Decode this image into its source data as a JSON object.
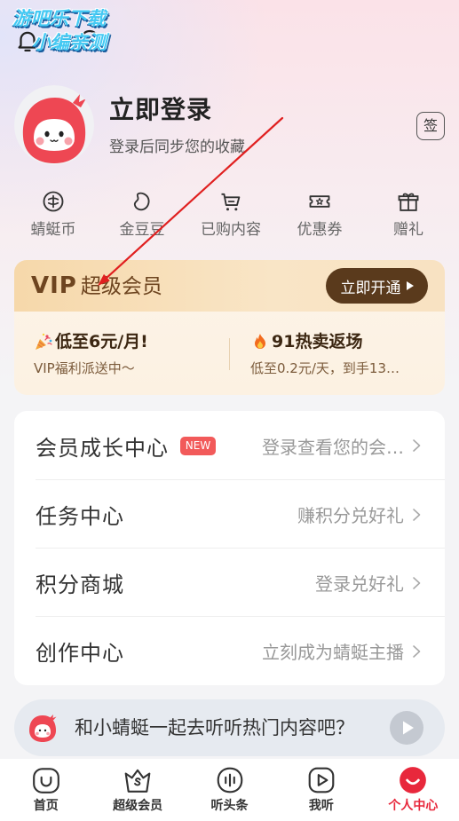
{
  "watermark": {
    "line1": "游吧乐下载",
    "line2": "小编亲测"
  },
  "top_bar": {
    "left_icons": [
      "bell-icon",
      "headset-icon"
    ]
  },
  "profile": {
    "title": "立即登录",
    "subtitle": "登录后同步您的收藏",
    "sign_label": "签"
  },
  "quick_links": [
    {
      "label": "蜻蜓币",
      "icon": "dragonfly-coin-icon"
    },
    {
      "label": "金豆豆",
      "icon": "bean-icon"
    },
    {
      "label": "已购内容",
      "icon": "cart-icon"
    },
    {
      "label": "优惠券",
      "icon": "coupon-icon"
    },
    {
      "label": "赠礼",
      "icon": "gift-icon"
    }
  ],
  "vip": {
    "badge": "VIP",
    "title": "超级会员",
    "cta": "立即开通",
    "promos": [
      {
        "icon": "party-popper-icon",
        "title": "低至6元/月!",
        "desc": "VIP福利派送中～"
      },
      {
        "icon": "fire-icon",
        "title": "91热卖返场",
        "desc": "低至0.2元/天，到手13…"
      }
    ]
  },
  "menu": [
    {
      "label": "会员成长中心",
      "badge": "NEW",
      "hint": "登录查看您的会…"
    },
    {
      "label": "任务中心",
      "hint": "赚积分兑好礼"
    },
    {
      "label": "积分商城",
      "hint": "登录兑好礼"
    },
    {
      "label": "创作中心",
      "hint": "立刻成为蜻蜓主播"
    }
  ],
  "banner": {
    "text": "和小蜻蜓一起去听听热门内容吧？",
    "icon": "play-icon"
  },
  "bottom_nav": [
    {
      "label": "首页",
      "icon": "home-icon",
      "active": false
    },
    {
      "label": "超级会员",
      "icon": "vip-crown-icon",
      "active": false
    },
    {
      "label": "听头条",
      "icon": "headline-icon",
      "active": false
    },
    {
      "label": "我听",
      "icon": "my-listen-icon",
      "active": false
    },
    {
      "label": "个人中心",
      "icon": "profile-icon",
      "active": true
    }
  ],
  "colors": {
    "accent": "#e8283c",
    "vip_cta_bg": "#5a3a1c",
    "vip_text": "#6e4520",
    "new_badge": "#f25a5a",
    "hint_text": "#999999",
    "annotation_arrow": "#e02020"
  }
}
